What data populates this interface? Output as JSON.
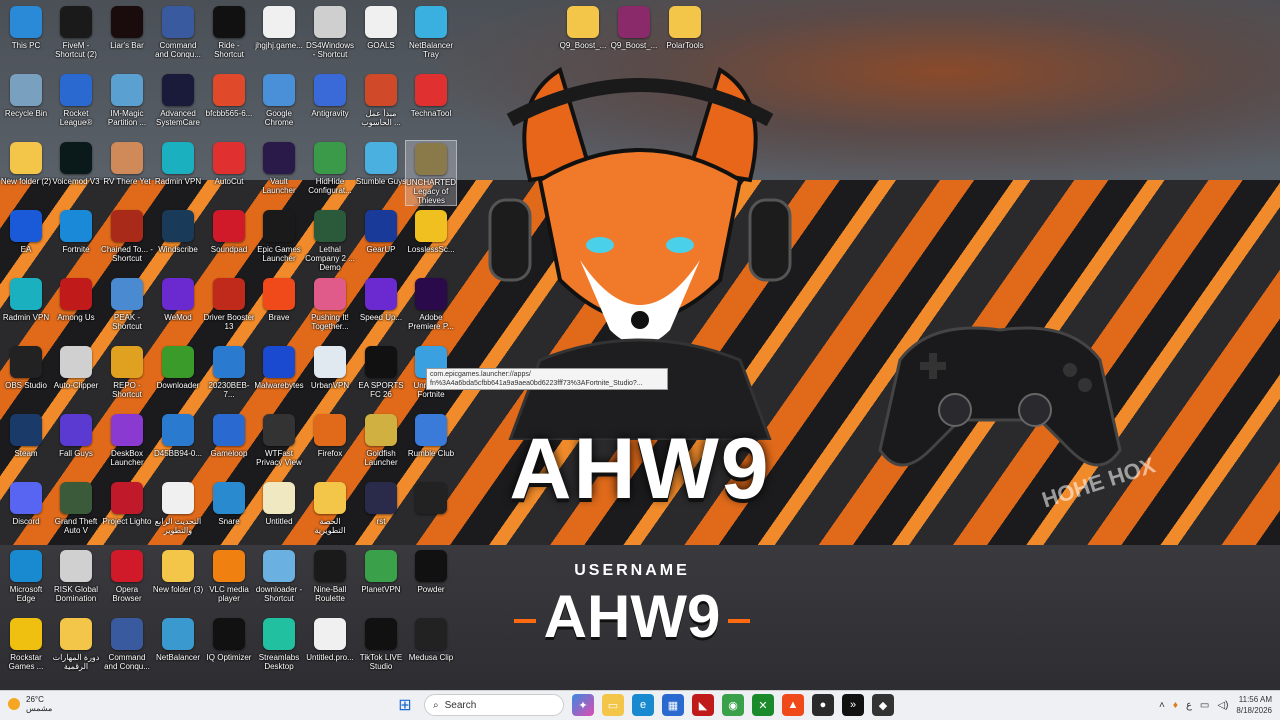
{
  "wallpaper": {
    "main_logo": "AHW9",
    "username_label": "USERNAME",
    "username_logo": "AHW9",
    "side_text": "HOHE HOX"
  },
  "tooltip": "com.epicgames.launcher://apps/ fn%3A4a6bda5cfbb641a9a9aea0bd6223fff73%3AFortnite_Studio?...",
  "icons": [
    {
      "label": "This PC",
      "name": "this-pc-icon",
      "color": "#2a8ad8"
    },
    {
      "label": "FiveM - Shortcut (2)",
      "name": "fivem-icon",
      "color": "#1a1a1a"
    },
    {
      "label": "Liar's Bar",
      "name": "liars-bar-icon",
      "color": "#1a0c0c"
    },
    {
      "label": "Command and Conqu...",
      "name": "command-conquer-icon",
      "color": "#3a5aa0"
    },
    {
      "label": "Ride - Shortcut",
      "name": "unreal-ride-icon",
      "color": "#111"
    },
    {
      "label": "jhgjhj.game...",
      "name": "file-icon",
      "color": "#f0f0f0"
    },
    {
      "label": "DS4Windows - Shortcut",
      "name": "ds4windows-icon",
      "color": "#cfcfcf"
    },
    {
      "label": "GOALS",
      "name": "document-icon",
      "color": "#f0f0f0"
    },
    {
      "label": "NetBalancer Tray",
      "name": "netbalancer-tray-icon",
      "color": "#3ab0e0"
    },
    {
      "label": "Recycle Bin",
      "name": "recycle-bin-icon",
      "color": "#7aa0c0"
    },
    {
      "label": "Rocket League®",
      "name": "rocket-league-icon",
      "color": "#2a6ad0"
    },
    {
      "label": "IM-Magic Partition ...",
      "name": "partition-icon",
      "color": "#5aa0d0"
    },
    {
      "label": "Advanced SystemCare",
      "name": "systemcare-icon",
      "color": "#1a1a3a"
    },
    {
      "label": "bfcbb565-6...",
      "name": "brave-file-icon",
      "color": "#e04a2a"
    },
    {
      "label": "Google Chrome",
      "name": "chrome-icon",
      "color": "#4a90d8"
    },
    {
      "label": "Antigravity",
      "name": "antigravity-icon",
      "color": "#3a6ad8"
    },
    {
      "label": "مبدأ عمل الحاسوب ...",
      "name": "powerpoint-icon",
      "color": "#d04a2a"
    },
    {
      "label": "TechnaTool",
      "name": "technatool-icon",
      "color": "#e03030"
    },
    {
      "label": "New folder (2)",
      "name": "folder-icon",
      "color": "#f3c649"
    },
    {
      "label": "Voicemod V3",
      "name": "voicemod-icon",
      "color": "#0a1a1a"
    },
    {
      "label": "RV There Yet",
      "name": "rv-there-yet-icon",
      "color": "#d08a5a"
    },
    {
      "label": "Radmin VPN",
      "name": "radmin-vpn-icon",
      "color": "#1ab0c0"
    },
    {
      "label": "AutoCut",
      "name": "autocut-icon",
      "color": "#e03030"
    },
    {
      "label": "Vault Launcher",
      "name": "vault-launcher-icon",
      "color": "#2a1a4a"
    },
    {
      "label": "HidHide Configurat...",
      "name": "hidhide-icon",
      "color": "#3a9a4a"
    },
    {
      "label": "Stumble Guys",
      "name": "stumble-guys-icon",
      "color": "#4ab0e0"
    },
    {
      "label": "UNCHARTED Legacy of Thieves Collection",
      "name": "uncharted-icon",
      "color": "#8a7a4a"
    },
    {
      "label": "EA",
      "name": "ea-icon",
      "color": "#1a5ad8"
    },
    {
      "label": "Fortnite",
      "name": "fortnite-icon",
      "color": "#1a8ad8"
    },
    {
      "label": "Chained To... - Shortcut",
      "name": "chained-together-icon",
      "color": "#aa2a1a"
    },
    {
      "label": "Windscribe",
      "name": "windscribe-icon",
      "color": "#1a3a5a"
    },
    {
      "label": "Soundpad",
      "name": "soundpad-icon",
      "color": "#d01a2a"
    },
    {
      "label": "Epic Games Launcher",
      "name": "epic-games-icon",
      "color": "#1a1a1a"
    },
    {
      "label": "Lethal Company 2 ... Demo",
      "name": "lethal-demo-icon",
      "color": "#2a5a3a"
    },
    {
      "label": "GearUP",
      "name": "gearup-icon",
      "color": "#1a3a9a"
    },
    {
      "label": "LosslessSc...",
      "name": "lossless-scaling-icon",
      "color": "#f0c020"
    },
    {
      "label": "Radmin VPN",
      "name": "radmin-vpn-2-icon",
      "color": "#1ab0c0"
    },
    {
      "label": "Among Us",
      "name": "among-us-icon",
      "color": "#c01a1a"
    },
    {
      "label": "PEAK - Shortcut",
      "name": "peak-icon",
      "color": "#4a8ad0"
    },
    {
      "label": "WeMod",
      "name": "wemod-icon",
      "color": "#6a2ad0"
    },
    {
      "label": "Driver Booster 13",
      "name": "driver-booster-icon",
      "color": "#c02a1a"
    },
    {
      "label": "Brave",
      "name": "brave-icon",
      "color": "#f04a1a"
    },
    {
      "label": "Pushing It! Together...",
      "name": "pushing-it-icon",
      "color": "#e05a8a"
    },
    {
      "label": "Speed Up...",
      "name": "speedup-icon",
      "color": "#6a2ad0"
    },
    {
      "label": "Adobe Premiere P...",
      "name": "premiere-icon",
      "color": "#2a0a4a"
    },
    {
      "label": "OBS Studio",
      "name": "obs-icon",
      "color": "#222"
    },
    {
      "label": "Auto-Clipper",
      "name": "auto-clipper-icon",
      "color": "#d0d0d0"
    },
    {
      "label": "REPO - Shortcut",
      "name": "repo-icon",
      "color": "#e0a020"
    },
    {
      "label": "Downloader",
      "name": "downloader-icon",
      "color": "#3a9a2a"
    },
    {
      "label": "20230BEB-7...",
      "name": "image-file-icon",
      "color": "#2a7ad0"
    },
    {
      "label": "Malwarebytes",
      "name": "malwarebytes-icon",
      "color": "#1a4ad0"
    },
    {
      "label": "UrbanVPN",
      "name": "urban-vpn-icon",
      "color": "#e0e8f0"
    },
    {
      "label": "EA SPORTS FC 26",
      "name": "ea-fc26-icon",
      "color": "#111"
    },
    {
      "label": "Unreal for Fortnite",
      "name": "unreal-fortnite-icon",
      "color": "#3aa0e0"
    },
    {
      "label": "Steam",
      "name": "steam-icon",
      "color": "#1a3a6a"
    },
    {
      "label": "Fall Guys",
      "name": "fall-guys-icon",
      "color": "#5a3ad0"
    },
    {
      "label": "DeskBox Launcher",
      "name": "deskbox-icon",
      "color": "#8a3ad0"
    },
    {
      "label": "D45BB94-0...",
      "name": "image-file-2-icon",
      "color": "#2a7ad0"
    },
    {
      "label": "Gameloop",
      "name": "gameloop-icon",
      "color": "#2a6ad0"
    },
    {
      "label": "WTFast Privacy View",
      "name": "privacy-view-icon",
      "color": "#333"
    },
    {
      "label": "Firefox",
      "name": "firefox-icon",
      "color": "#e06a1a"
    },
    {
      "label": "Goldfish Launcher",
      "name": "goldfish-icon",
      "color": "#d0b040"
    },
    {
      "label": "Rumble Club",
      "name": "rumble-club-icon",
      "color": "#3a7ad8"
    },
    {
      "label": "Discord",
      "name": "discord-icon",
      "color": "#5865f2"
    },
    {
      "label": "Grand Theft Auto V",
      "name": "gta-v-icon",
      "color": "#3a5a3a"
    },
    {
      "label": "Project Lighto",
      "name": "project-lighto-icon",
      "color": "#c01a2a"
    },
    {
      "label": "التحديث الرابع والتطوير",
      "name": "pdf-file-icon",
      "color": "#f0f0f0"
    },
    {
      "label": "Snare",
      "name": "edge-file-icon",
      "color": "#2a8ad0"
    },
    {
      "label": "Untitled",
      "name": "untitled-file-icon",
      "color": "#f0e8c0"
    },
    {
      "label": "الحصة التطويرية",
      "name": "folder-2-icon",
      "color": "#f3c649"
    },
    {
      "label": "rst",
      "name": "rst-file-icon",
      "color": "#2a2a4a"
    },
    {
      "label": "",
      "name": "circle-app-icon",
      "color": "#222"
    },
    {
      "label": "Microsoft Edge",
      "name": "edge-icon",
      "color": "#1a8ad0"
    },
    {
      "label": "RISK Global Domination",
      "name": "risk-icon",
      "color": "#d0d0d0"
    },
    {
      "label": "Opera Browser",
      "name": "opera-icon",
      "color": "#d01a2a"
    },
    {
      "label": "New folder (3)",
      "name": "folder-3-icon",
      "color": "#f3c649"
    },
    {
      "label": "VLC media player",
      "name": "vlc-icon",
      "color": "#f08010"
    },
    {
      "label": "downloader - Shortcut",
      "name": "anime-downloader-icon",
      "color": "#6ab0e0"
    },
    {
      "label": "Nine-Ball Roulette",
      "name": "nine-ball-icon",
      "color": "#1a1a1a"
    },
    {
      "label": "PlanetVPN",
      "name": "planet-vpn-icon",
      "color": "#3aa04a"
    },
    {
      "label": "Powder",
      "name": "powder-icon",
      "color": "#111"
    },
    {
      "label": "Rockstar Games ...",
      "name": "rockstar-icon",
      "color": "#f0c010"
    },
    {
      "label": "دورة المهارات الرقمية",
      "name": "folder-4-icon",
      "color": "#f3c649"
    },
    {
      "label": "Command and Conqu...",
      "name": "command-conquer-2-icon",
      "color": "#3a5aa0"
    },
    {
      "label": "NetBalancer",
      "name": "netbalancer-icon",
      "color": "#3a9ad0"
    },
    {
      "label": "IQ Optimizer",
      "name": "iq-optimizer-icon",
      "color": "#111"
    },
    {
      "label": "Streamlabs Desktop",
      "name": "streamlabs-icon",
      "color": "#20c0a0"
    },
    {
      "label": "Untitled.pro...",
      "name": "untitled-pro-file-icon",
      "color": "#f0f0f0"
    },
    {
      "label": "TikTok LIVE Studio",
      "name": "tiktok-live-icon",
      "color": "#111"
    },
    {
      "label": "Medusa Clip",
      "name": "medusa-clip-icon",
      "color": "#222"
    },
    {
      "label": "Q9_Boost_...",
      "name": "q9-boost-folder-icon",
      "color": "#f3c649"
    },
    {
      "label": "Q9_Boost_...",
      "name": "q9-boost-rar-icon",
      "color": "#8a2a6a"
    },
    {
      "label": "PolarTools",
      "name": "polartools-folder-icon",
      "color": "#f3c649"
    }
  ],
  "taskbar": {
    "weather_temp": "26°C",
    "weather_desc": "مشمس",
    "search_placeholder": "Search",
    "time": "11:56 AM",
    "date": "8/18/2026",
    "lang": "ع"
  }
}
